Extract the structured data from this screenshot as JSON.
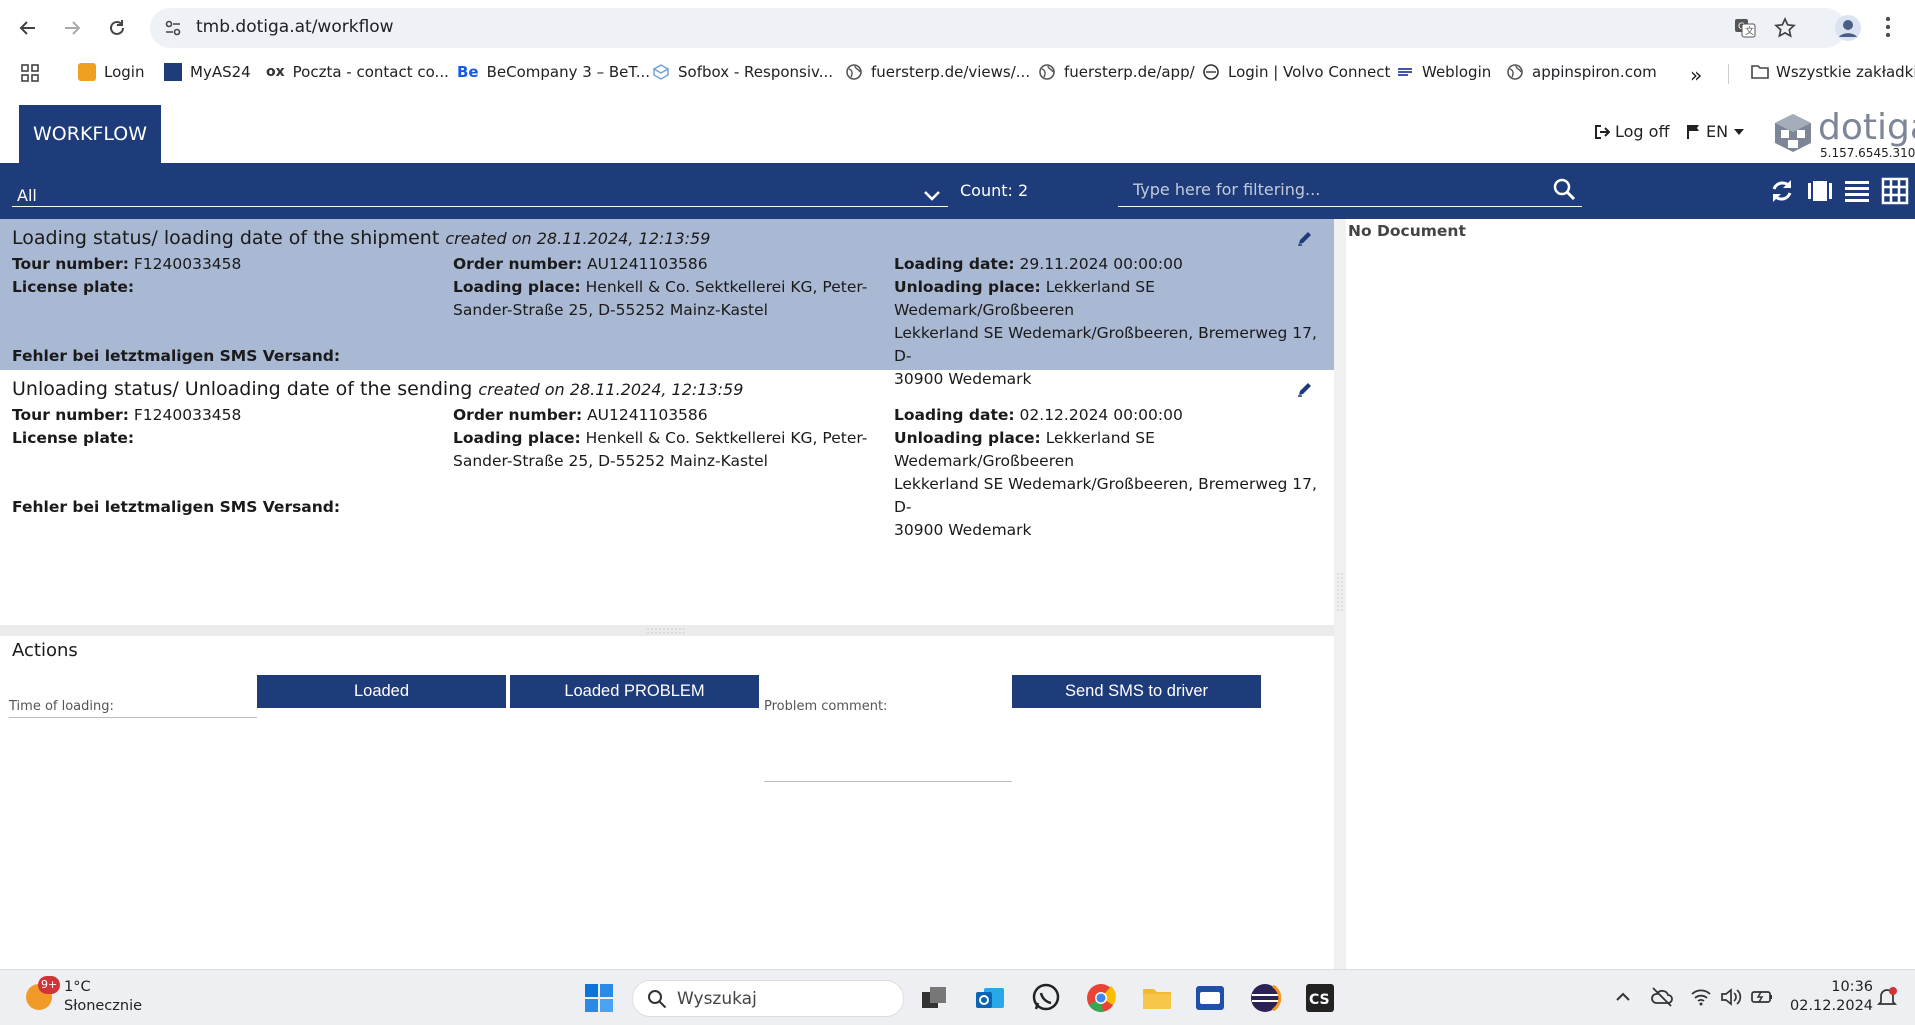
{
  "browser": {
    "url": "tmb.dotiga.at/workflow",
    "bookmarks": [
      {
        "label": "Login"
      },
      {
        "label": "MyAS24"
      },
      {
        "label": "Poczta - contact co..."
      },
      {
        "label": "BeCompany 3 – BeT..."
      },
      {
        "label": "Sofbox - Responsiv..."
      },
      {
        "label": "fuersterp.de/views/..."
      },
      {
        "label": "fuersterp.de/app/"
      },
      {
        "label": "Login | Volvo Connect"
      },
      {
        "label": "Weblogin"
      },
      {
        "label": "appinspiron.com"
      }
    ],
    "all_bookmarks": "Wszystkie zakładki",
    "overflow": "»"
  },
  "header": {
    "tab": "WORKFLOW",
    "logoff": "Log off",
    "lang": "EN",
    "logo": "dotiga",
    "version": "5.157.6545.310"
  },
  "toolbar": {
    "filter_value": "All",
    "count": "Count: 2",
    "search_placeholder": "Type here for filtering..."
  },
  "cards": [
    {
      "title": "Loading status/ loading date of the shipment",
      "created": "created on 28.11.2024, 12:13:59",
      "tour_label": "Tour number:",
      "tour": "F1240033458",
      "order_label": "Order number:",
      "order": "AU1241103586",
      "loading_date_label": "Loading date:",
      "loading_date": "29.11.2024 00:00:00",
      "plate_label": "License plate:",
      "loading_place_label": "Loading place:",
      "loading_place_1": "Henkell & Co. Sektkellerei KG, Peter-",
      "loading_place_2": "Sander-Straße 25, D-55252 Mainz-Kastel",
      "unloading_place_label": "Unloading place:",
      "unloading_place_1": "Lekkerland SE Wedemark/Großbeeren",
      "unloading_place_2": "Lekkerland SE Wedemark/Großbeeren, Bremerweg 17, D-",
      "unloading_place_3": "30900 Wedemark",
      "sms_label": "Fehler bei letztmaligen SMS Versand:"
    },
    {
      "title": "Unloading status/ Unloading date of the sending",
      "created": "created on 28.11.2024, 12:13:59",
      "tour_label": "Tour number:",
      "tour": "F1240033458",
      "order_label": "Order number:",
      "order": "AU1241103586",
      "loading_date_label": "Loading date:",
      "loading_date": "02.12.2024 00:00:00",
      "plate_label": "License plate:",
      "loading_place_label": "Loading place:",
      "loading_place_1": "Henkell & Co. Sektkellerei KG, Peter-",
      "loading_place_2": "Sander-Straße 25, D-55252 Mainz-Kastel",
      "unloading_place_label": "Unloading place:",
      "unloading_place_1": "Lekkerland SE Wedemark/Großbeeren",
      "unloading_place_2": "Lekkerland SE Wedemark/Großbeeren, Bremerweg 17, D-",
      "unloading_place_3": "30900 Wedemark",
      "sms_label": "Fehler bei letztmaligen SMS Versand:"
    }
  ],
  "document": {
    "empty": "No Document"
  },
  "actions": {
    "title": "Actions",
    "time_label": "Time of loading:",
    "loaded": "Loaded",
    "loaded_problem": "Loaded PROBLEM",
    "problem_label": "Problem comment:",
    "send_sms": "Send SMS to driver"
  },
  "taskbar": {
    "badge": "9+",
    "temp": "1°C",
    "weather": "Słonecznie",
    "search": "Wyszukaj",
    "time": "10:36",
    "date": "02.12.2024"
  },
  "colors": {
    "brand": "#1e3c7a",
    "selected": "#a9b8d3"
  }
}
